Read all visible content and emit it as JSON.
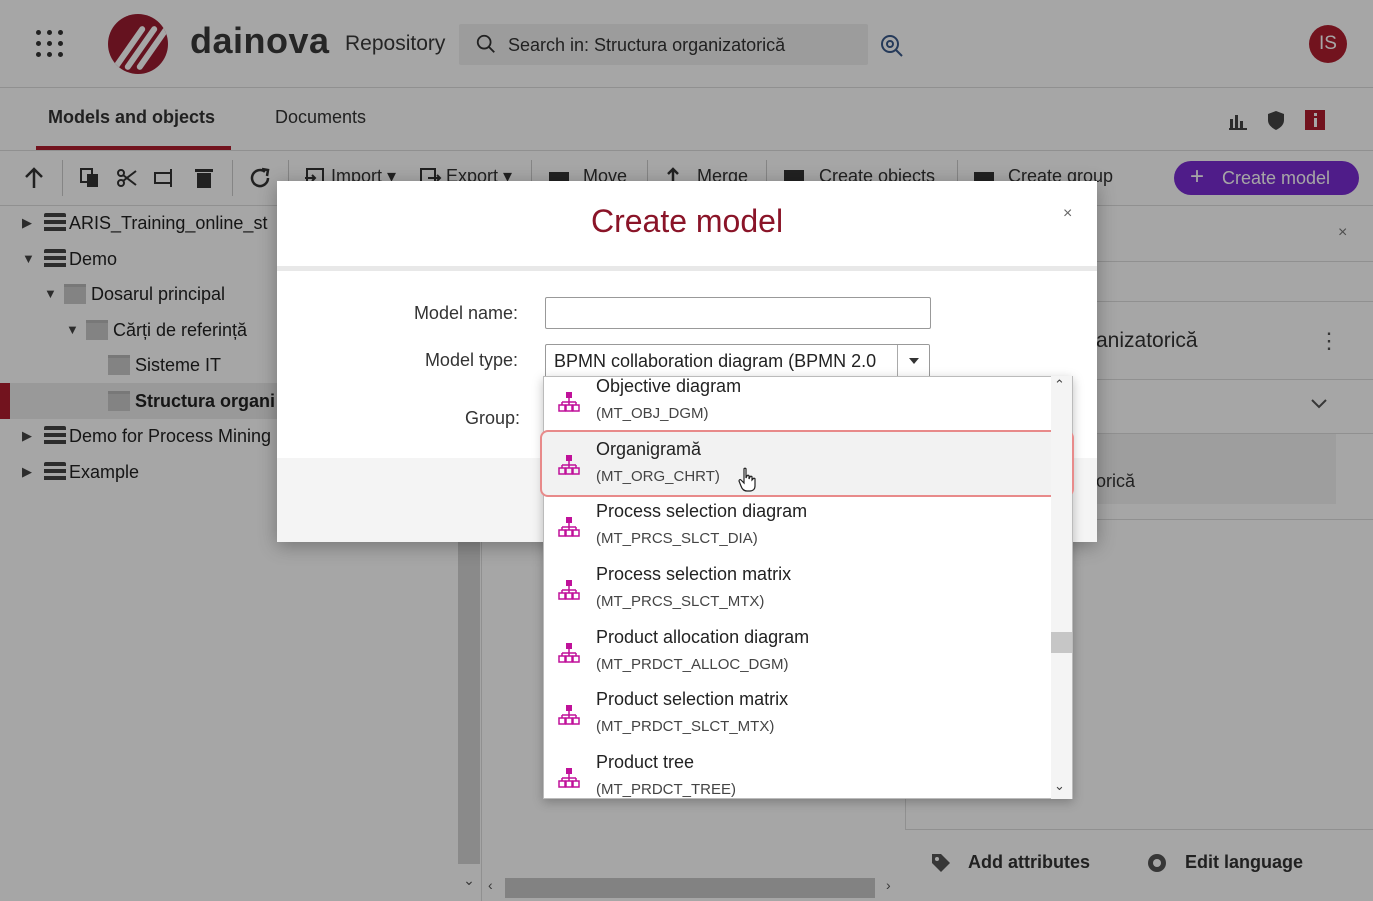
{
  "header": {
    "logo_text": "dainova",
    "app_name": "Repository",
    "search_text": "Search in: Structura organizatorică",
    "avatar_initials": "IS"
  },
  "tabs": [
    {
      "label": "Models and objects",
      "active": true
    },
    {
      "label": "Documents",
      "active": false
    }
  ],
  "toolbar": {
    "import": "Import",
    "export": "Export",
    "move": "Move",
    "merge": "Merge",
    "create_objects": "Create objects",
    "create_group": "Create group",
    "create_model": "Create model"
  },
  "tree": [
    {
      "label": "ARIS_Training_online_st",
      "type": "database",
      "level": 0,
      "expanded": false
    },
    {
      "label": "Demo",
      "type": "database",
      "level": 0,
      "expanded": true
    },
    {
      "label": "Dosarul principal",
      "type": "folder",
      "level": 1,
      "expanded": true
    },
    {
      "label": "Cărți de referință",
      "type": "folder",
      "level": 2,
      "expanded": true
    },
    {
      "label": "Sisteme IT",
      "type": "folder",
      "level": 3
    },
    {
      "label": "Structura organi",
      "type": "folder",
      "level": 3,
      "selected": true
    },
    {
      "label": "Demo for Process Mining",
      "type": "database",
      "level": 0,
      "expanded": false
    },
    {
      "label": "Example",
      "type": "database",
      "level": 0,
      "expanded": false
    }
  ],
  "right_panel": {
    "title": "anizatorică",
    "card_text": "orică",
    "add_attributes": "Add attributes",
    "edit_language": "Edit language"
  },
  "dialog": {
    "title": "Create model",
    "close": "×",
    "model_name_label": "Model name:",
    "model_name_value": "",
    "model_type_label": "Model type:",
    "model_type_value": "BPMN collaboration diagram (BPMN 2.0",
    "group_label": "Group:"
  },
  "dropdown_items": [
    {
      "name": "Objective diagram",
      "code": "(MT_OBJ_DGM)"
    },
    {
      "name": "Organigramă",
      "code": "(MT_ORG_CHRT)",
      "hovered": true
    },
    {
      "name": "Process selection diagram",
      "code": "(MT_PRCS_SLCT_DIA)"
    },
    {
      "name": "Process selection matrix",
      "code": "(MT_PRCS_SLCT_MTX)"
    },
    {
      "name": "Product allocation diagram",
      "code": "(MT_PRDCT_ALLOC_DGM)"
    },
    {
      "name": "Product selection matrix",
      "code": "(MT_PRDCT_SLCT_MTX)"
    },
    {
      "name": "Product tree",
      "code": "(MT_PRDCT_TREE)"
    }
  ],
  "colors": {
    "brand": "#b01e2e",
    "title_red": "#8a1428",
    "primary_button": "#7a2bd3",
    "model_icon": "#c0119a"
  }
}
